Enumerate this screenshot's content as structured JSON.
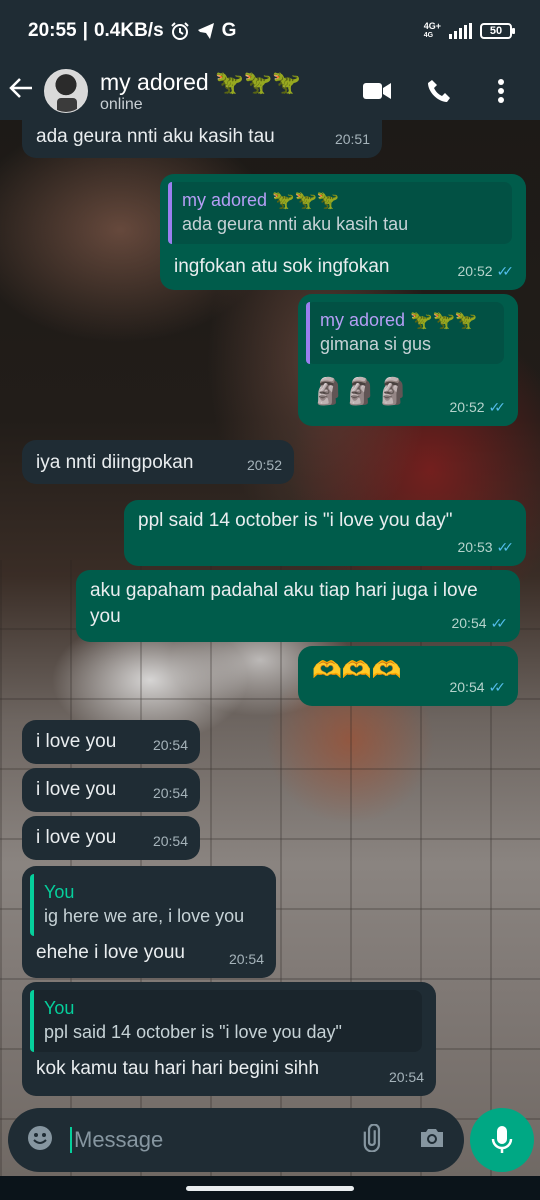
{
  "status_bar": {
    "time": "20:55",
    "speed": "0.4KB/s",
    "net_label_top": "4G+",
    "net_label_bottom": "4G",
    "battery": "50",
    "g_label": "G"
  },
  "header": {
    "contact_name": "my adored 🦖🦖🦖",
    "status": "online"
  },
  "messages": [
    {
      "dir": "in",
      "text": "ada geura nnti aku kasih tau",
      "time": "20:51"
    },
    {
      "dir": "out",
      "quote_author": "my adored 🦖🦖🦖",
      "quote_text": "ada geura nnti aku kasih tau",
      "text": "ingfokan atu sok ingfokan",
      "time": "20:52"
    },
    {
      "dir": "out",
      "quote_author": "my adored 🦖🦖🦖",
      "quote_text": "gimana si gus",
      "text": "🗿🗿🗿",
      "time": "20:52"
    },
    {
      "dir": "in",
      "text": "iya nnti diingpokan",
      "time": "20:52"
    },
    {
      "dir": "out",
      "text": "ppl said 14 october is \"i love you day\"",
      "time": "20:53"
    },
    {
      "dir": "out",
      "text": "aku gapaham padahal aku tiap hari juga i love you",
      "time": "20:54"
    },
    {
      "dir": "out",
      "text": "🫶🫶🫶",
      "time": "20:54"
    },
    {
      "dir": "in",
      "text": "i love you",
      "time": "20:54"
    },
    {
      "dir": "in",
      "text": "i love you",
      "time": "20:54"
    },
    {
      "dir": "in",
      "text": "i love you",
      "time": "20:54"
    },
    {
      "dir": "in",
      "quote_author": "You",
      "quote_text": "ig here we are, i love you",
      "text": "ehehe i love youu",
      "time": "20:54"
    },
    {
      "dir": "in",
      "quote_author": "You",
      "quote_text": "ppl said 14 october is \"i love you day\"",
      "text": "kok kamu tau hari hari begini sihh",
      "time": "20:54"
    }
  ],
  "input": {
    "placeholder": "Message"
  },
  "colors": {
    "incoming_bubble": "#1f2c34",
    "outgoing_bubble": "#005c4b",
    "accent": "#00a884",
    "read_ticks": "#53bdeb"
  }
}
